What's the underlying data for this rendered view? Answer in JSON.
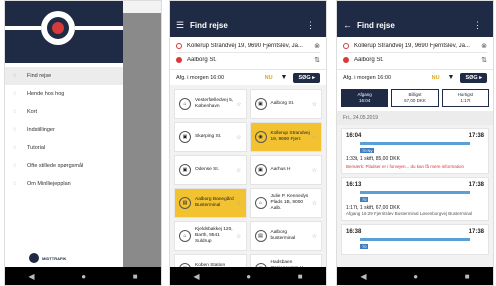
{
  "drawer": {
    "items": [
      {
        "label": "Find rejse",
        "icon": "search-icon"
      },
      {
        "label": "Hende hos hog",
        "icon": "clock-icon"
      },
      {
        "label": "Kort",
        "icon": "map-icon"
      },
      {
        "label": "Indstillinger",
        "icon": "settings-icon"
      },
      {
        "label": "Tutorial",
        "icon": "help-icon"
      },
      {
        "label": "Ofte stillede spørgsmål",
        "icon": "question-icon"
      },
      {
        "label": "Om Minlliejepplan",
        "icon": "info-icon"
      }
    ],
    "footer_brand": "MIDTTRAFIK"
  },
  "fav_screen": {
    "title": "Find rejse",
    "from": "Kollerup Strandvej 19, 9690 Fjerritslev, Ja...",
    "to": "Aalborg St.",
    "time_label": "Afg. i morgen 16:00",
    "now_label": "NU",
    "search_label": "SØG ▸",
    "favorites": [
      {
        "label": "Vesterfælledvej 5, København",
        "icon": "home-icon",
        "selected": false
      },
      {
        "label": "Aalborg St.",
        "icon": "train-icon",
        "selected": false
      },
      {
        "label": "Skørping St.",
        "icon": "train-icon",
        "selected": false
      },
      {
        "label": "Kollerup Strandvej 19, 9690 Fjerr.",
        "icon": "pin-icon",
        "selected": true
      },
      {
        "label": "Odense St.",
        "icon": "train-icon",
        "selected": false
      },
      {
        "label": "Aarhus H",
        "icon": "train-icon",
        "selected": false
      },
      {
        "label": "Aalborg Banegård Busterminal",
        "icon": "bus-icon",
        "selected": true
      },
      {
        "label": "Julie P. Kennedys Plads 1B, 9000 Aalb.",
        "icon": "home-icon",
        "selected": false
      },
      {
        "label": "Kjeldsbakkej 120, Barth, 9541 Suldrup",
        "icon": "home-icon",
        "selected": false
      },
      {
        "label": "Aalborg busterminal",
        "icon": "bus-icon",
        "selected": false
      },
      {
        "label": "Koben Station (bus)",
        "icon": "bus-icon",
        "selected": false
      },
      {
        "label": "Hadsbaen Ossiansumm H 20000",
        "icon": "bus-icon",
        "selected": false
      }
    ]
  },
  "res_screen": {
    "title": "Find rejse",
    "from": "Kollerup Strandvej 19, 9690 Fjerritslev, Ja...",
    "to": "Aalborg St.",
    "time_label": "Afg. i morgen 16:00",
    "now_label": "NU",
    "search_label": "SØG ▸",
    "tabs": [
      {
        "top": "Afgang",
        "bottom": "16:04"
      },
      {
        "top": "Billigst",
        "bottom": "67,00 DKK"
      },
      {
        "top": "Hurtigst",
        "bottom": "1:17t"
      }
    ],
    "date": "Fri., 24.05.2019",
    "trips": [
      {
        "dep": "16:04",
        "arr": "17:38",
        "badge": "70 Ny",
        "info": "1:33t, 1 skift, 85,00 DKK",
        "note": "Bemærk: Pladser er i forvejen... du kan få mere information",
        "sub": ""
      },
      {
        "dep": "16:13",
        "arr": "17:38",
        "badge": "70",
        "info": "1:17t, 1 skift, 67,00 DKK",
        "note": "",
        "sub": "Afgang 16:29 Fjerritslev Busterminal Løvenborgvej Busterminal"
      },
      {
        "dep": "16:38",
        "arr": "17:38",
        "badge": "70",
        "info": "",
        "note": "",
        "sub": ""
      }
    ]
  },
  "nav": {
    "back": "◀",
    "home": "●",
    "recent": "■"
  }
}
